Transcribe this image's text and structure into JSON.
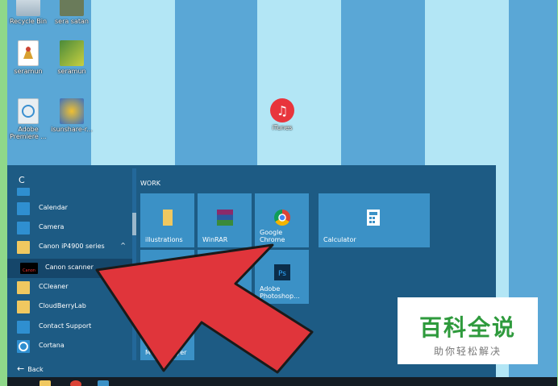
{
  "desktop": {
    "icons": [
      {
        "label": "Recycle Bin",
        "icon": "recycle-bin-icon"
      },
      {
        "label": "sera satan",
        "icon": "app-icon"
      },
      {
        "label": "seramun",
        "icon": "document-icon"
      },
      {
        "label": "seramun",
        "icon": "image-icon"
      },
      {
        "label": "Adobe Premiere ...",
        "icon": "adobe-premiere-icon"
      },
      {
        "label": "isunshare-r...",
        "icon": "isunshare-icon"
      },
      {
        "label": "iTunes",
        "icon": "itunes-icon"
      }
    ]
  },
  "start_menu": {
    "letter": "C",
    "apps": [
      {
        "label": "Calendar",
        "expand": ""
      },
      {
        "label": "Camera",
        "expand": ""
      },
      {
        "label": "Canon iP4900 series",
        "expand": "^"
      },
      {
        "label": "Canon scanner",
        "expand": ""
      },
      {
        "label": "CCleaner",
        "expand": ""
      },
      {
        "label": "CloudBerryLab",
        "expand": "v"
      },
      {
        "label": "Contact Support",
        "expand": ""
      },
      {
        "label": "Cortana",
        "expand": ""
      }
    ],
    "back_label": "Back",
    "group_label": "WORK",
    "tiles": [
      {
        "label": "illustrations",
        "icon": "folder-icon"
      },
      {
        "label": "WinRAR",
        "icon": "winrar-icon"
      },
      {
        "label": "Google Chrome",
        "icon": "chrome-icon"
      },
      {
        "label": "Calculator",
        "icon": "calculator-icon"
      },
      {
        "label": "Adobe Photoshop...",
        "icon": "photoshop-icon"
      },
      {
        "label": "Windows Media Player",
        "icon": "media-player-icon"
      }
    ]
  },
  "watermark": {
    "title": "百科全说",
    "subtitle": "助你轻松解决"
  },
  "colors": {
    "stripe_dark": "#5aa7d6",
    "stripe_light": "#b3e6f5",
    "start_bg": "#1d5b84",
    "tile_bg": "#3b91c6",
    "arrow": "#e0353b",
    "watermark_green": "#2e9a3c"
  }
}
